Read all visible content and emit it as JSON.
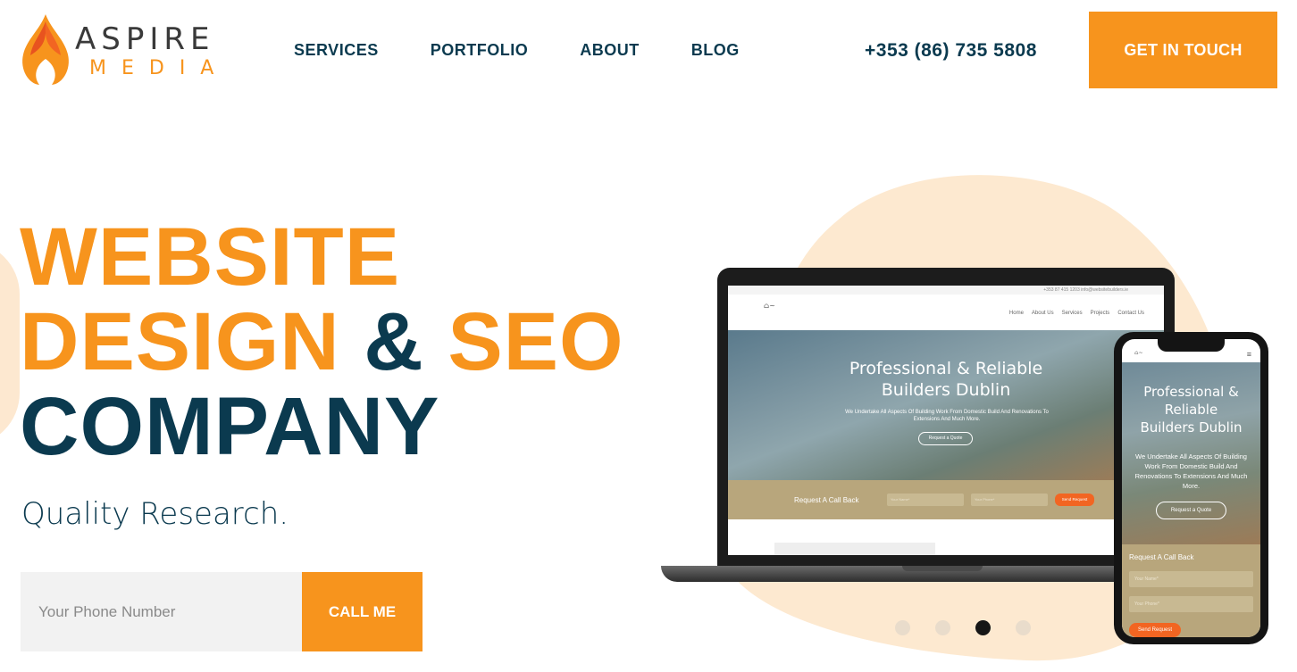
{
  "brand": {
    "name": "ASPIRE",
    "sub": "MEDIA",
    "accent": "#f7941d",
    "navy": "#0b3a4f"
  },
  "nav": {
    "items": [
      "SERVICES",
      "PORTFOLIO",
      "ABOUT",
      "BLOG"
    ]
  },
  "header": {
    "phone": "+353 (86) 735 5808",
    "cta": "GET IN TOUCH"
  },
  "hero": {
    "line1": "WEBSITE",
    "line2_a": "DESIGN",
    "line2_b": "&",
    "line2_c": "SEO",
    "line3": "COMPANY",
    "tagline": "Quality Research."
  },
  "callback": {
    "placeholder": "Your Phone Number",
    "button": "CALL ME"
  },
  "laptop_site": {
    "topbar": "+353 87 415 1203   info@websitebuilders.ie",
    "menu": [
      "Home",
      "About Us",
      "Services",
      "Projects",
      "Contact Us"
    ],
    "title_1": "Professional & Reliable",
    "title_2": "Builders Dublin",
    "subtitle": "We Undertake All Aspects Of Building Work From Domestic Build And Renovations To Extensions And Much More.",
    "quote_button": "Request a Quote",
    "band_label": "Request A Call Back",
    "field_1": "Your Name*",
    "field_2": "Your Phone*",
    "send_button": "Send Request"
  },
  "phone_site": {
    "title_1": "Professional &",
    "title_2": "Reliable",
    "title_3": "Builders Dublin",
    "subtitle": "We Undertake All Aspects Of Building Work From Domestic Build And Renovations To Extensions And Much More.",
    "quote_button": "Request a Quote",
    "band_label": "Request A Call Back",
    "field_1": "Your Name*",
    "field_2": "Your Phone*",
    "send_button": "Send Request"
  },
  "carousel": {
    "count": 4,
    "active_index": 2
  }
}
